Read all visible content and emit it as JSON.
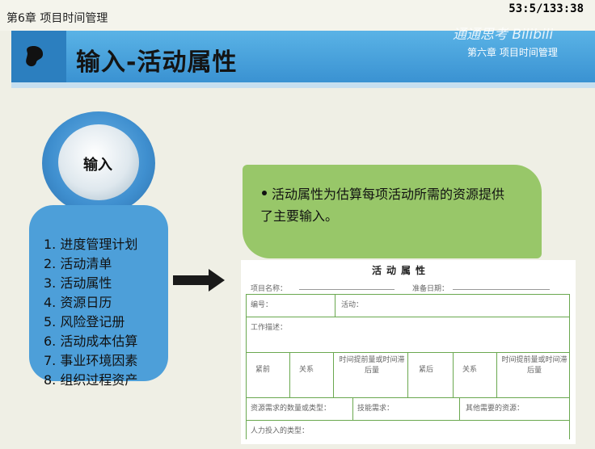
{
  "header": {
    "chapter_tag": "第6章 项目时间管理",
    "page_counter": "53:5/133:38",
    "title": "输入-活动属性",
    "brand": "通通思考 Bilibili",
    "chapter_subtitle": "第六章 项目时间管理"
  },
  "left": {
    "circle_label": "输入",
    "items": [
      "1. 进度管理计划",
      "2. 活动清单",
      "3. 活动属性",
      "4. 资源日历",
      "5. 风险登记册",
      "6. 活动成本估算",
      "7. 事业环境因素",
      "8. 组织过程资产"
    ]
  },
  "callout": {
    "text": "活动属性为估算每项活动所需的资源提供了主要输入。"
  },
  "document": {
    "title": "活动属性",
    "project_name": "项目名称：",
    "prepare_date": "准备日期：",
    "id": "编号：",
    "activity": "活动：",
    "work_description": "工作描述：",
    "predecessor": "紧前",
    "relation_1": "关系",
    "lead_lag_1": "时间提前量或时间滞后量",
    "successor": "紧后",
    "relation_2": "关系",
    "lead_lag_2": "时间提前量或时间滞后量",
    "resource_req": "资源需求的数量或类型：",
    "skill_req": "技能需求：",
    "other_resources": "其他需要的资源：",
    "effort_type": "人力投入的类型："
  },
  "colors": {
    "header_blue": "#3a92d2",
    "panel_blue": "#4d9fd9",
    "callout_green": "#98c769",
    "grid_green": "#6aa84f"
  },
  "icons": [
    "bean-icon",
    "right-arrow-icon"
  ]
}
